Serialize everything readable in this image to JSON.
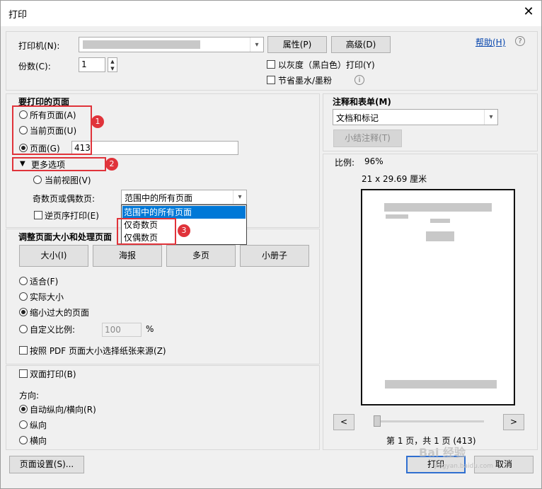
{
  "window": {
    "title": "打印",
    "close_glyph": "✕"
  },
  "printer": {
    "label": "打印机(N):",
    "properties_btn": "属性(P)",
    "advanced_btn": "高级(D)",
    "help_link": "帮助(H)",
    "copies_label": "份数(C):",
    "copies_value": "1",
    "grayscale_label": "以灰度（黑白色）打印(Y)",
    "save_ink_label": "节省墨水/墨粉"
  },
  "pages": {
    "title": "要打印的页面",
    "all_pages": "所有页面(A)",
    "current_page": "当前页面(U)",
    "pages_radio": "页面(G)",
    "pages_value": "413",
    "more_options": "更多选项",
    "current_view": "当前视图(V)",
    "odd_even_label": "奇数页或偶数页:",
    "odd_even_value": "范围中的所有页面",
    "odd_even_options": [
      "范围中的所有页面",
      "仅奇数页",
      "仅偶数页"
    ],
    "reverse_order": "逆页序打印(E)"
  },
  "badges": {
    "b1": "1",
    "b2": "2",
    "b3": "3"
  },
  "sizing": {
    "title": "调整页面大小和处理页面",
    "tabs": [
      "大小(I)",
      "海报",
      "多页",
      "小册子"
    ],
    "fit": "适合(F)",
    "actual_size": "实际大小",
    "shrink_oversized": "缩小过大的页面",
    "custom_scale": "自定义比例:",
    "custom_scale_value": "100",
    "percent": "%",
    "choose_paper": "按照 PDF 页面大小选择纸张来源(Z)"
  },
  "duplex": {
    "label": "双面打印(B)",
    "orientation_label": "方向:",
    "auto": "自动纵向/横向(R)",
    "portrait": "纵向",
    "landscape": "横向"
  },
  "comments": {
    "title": "注释和表单(M)",
    "value": "文档和标记",
    "summarize_btn": "小结注释(T)"
  },
  "preview": {
    "scale_label": "比例:",
    "scale_value": "96%",
    "paper_size": "21 x 29.69 厘米",
    "prev": "<",
    "next": ">",
    "page_info": "第 1 页，共 1 页 (413)"
  },
  "footer": {
    "page_setup": "页面设置(S)...",
    "print": "打印",
    "cancel": "取消"
  },
  "watermark": {
    "text": "Bai 经验",
    "url": "jingyan.baidu.com"
  },
  "colors": {
    "accent": "#0078d7",
    "annotation_red": "#e0333a"
  }
}
